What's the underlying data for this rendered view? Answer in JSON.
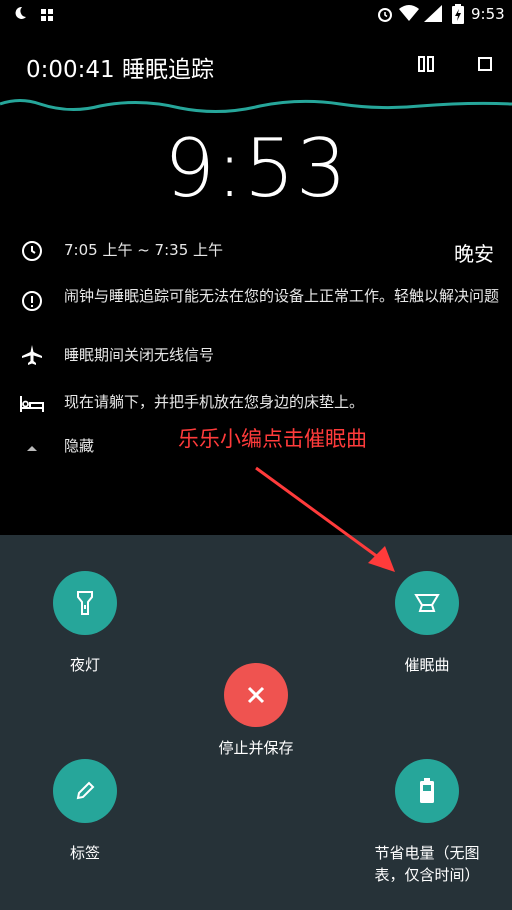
{
  "status_bar": {
    "time": "9:53"
  },
  "header": {
    "title": "0:00:41 睡眠追踪"
  },
  "clock": {
    "time": "9:53"
  },
  "info_rows": [
    {
      "text": "7:05 上午 ~ 7:35 上午",
      "icon": "clock-icon"
    },
    {
      "text": "闹钟与睡眠追踪可能无法在您的设备上正常工作。轻触以解决问题",
      "icon": "alert-circle-icon"
    },
    {
      "text": "睡眠期间关闭无线信号",
      "icon": "airplane-icon"
    },
    {
      "text": "现在请躺下，并把手机放在您身边的床垫上。",
      "icon": "bed-icon"
    },
    {
      "text": "隐藏",
      "icon": "caret-up-icon"
    }
  ],
  "goodnight": "晚安",
  "annotation": "乐乐小编点击催眠曲",
  "actions": {
    "night_light": "夜灯",
    "lullaby": "催眠曲",
    "stop_save": "停止并保存",
    "label": "标签",
    "battery_saver": "节省电量（无图表，仅含时间）"
  },
  "colors": {
    "teal": "#26a69a",
    "red": "#ef5350",
    "panel": "#263238",
    "annotation": "#ff3b3b"
  }
}
